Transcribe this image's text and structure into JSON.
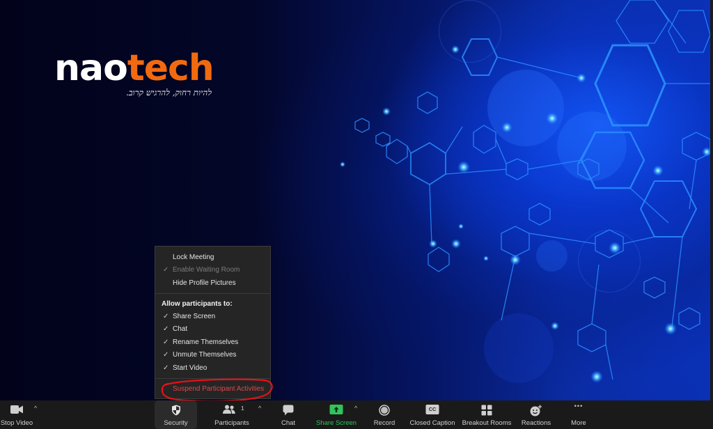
{
  "background": {
    "logo": {
      "part1": "nao",
      "part2": "tech",
      "tagline": "להיות רחוק, להרגיש קרוב.",
      "part1_color": "#ffffff",
      "part2_color": "#f26a10"
    }
  },
  "security_menu": {
    "items_top": [
      {
        "label": "Lock Meeting",
        "checked": false,
        "disabled": false
      },
      {
        "label": "Enable Waiting Room",
        "checked": true,
        "disabled": true
      },
      {
        "label": "Hide Profile Pictures",
        "checked": false,
        "disabled": false
      }
    ],
    "section_header": "Allow participants to:",
    "allow_items": [
      {
        "label": "Share Screen",
        "checked": true
      },
      {
        "label": "Chat",
        "checked": true
      },
      {
        "label": "Rename Themselves",
        "checked": true
      },
      {
        "label": "Unmute Themselves",
        "checked": true
      },
      {
        "label": "Start Video",
        "checked": true
      }
    ],
    "suspend_label": "Suspend Participant Activities",
    "check_glyph": "✓",
    "suspend_color": "#e0474c",
    "annotation_color": "#e8101a"
  },
  "toolbar": {
    "stop_video": "Stop Video",
    "security": "Security",
    "participants": "Participants",
    "participants_count": "1",
    "chat": "Chat",
    "share_screen": "Share Screen",
    "record": "Record",
    "closed_caption": "Closed Caption",
    "cc_glyph": "CC",
    "breakout_rooms": "Breakout Rooms",
    "reactions": "Reactions",
    "more": "More",
    "more_glyph": "•••",
    "caret_glyph": "^",
    "share_color": "#31c35c"
  }
}
